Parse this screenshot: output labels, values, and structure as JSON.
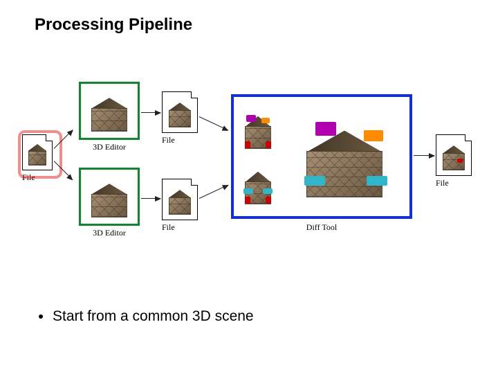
{
  "title": "Processing Pipeline",
  "bullet": "Start from a common 3D scene",
  "labels": {
    "file": "File",
    "editor": "3D Editor",
    "diff": "Diff Tool"
  },
  "diagram": {
    "description": "A source 3D scene file (highlighted) is edited in two parallel 3D Editor sessions, each producing a derived file. Both derived files feed a Diff Tool that compares the two versions and outputs a merged file.",
    "nodes": [
      {
        "id": "file_src",
        "kind": "file",
        "label_key": "file",
        "highlight": "red"
      },
      {
        "id": "editor_top",
        "kind": "editor",
        "label_key": "editor"
      },
      {
        "id": "editor_bot",
        "kind": "editor",
        "label_key": "editor"
      },
      {
        "id": "file_top",
        "kind": "file",
        "label_key": "file"
      },
      {
        "id": "file_bot",
        "kind": "file",
        "label_key": "file"
      },
      {
        "id": "diff",
        "kind": "diff",
        "label_key": "diff"
      },
      {
        "id": "file_out",
        "kind": "file",
        "label_key": "file"
      }
    ],
    "edges": [
      {
        "from": "file_src",
        "to": "editor_top"
      },
      {
        "from": "file_src",
        "to": "editor_bot"
      },
      {
        "from": "editor_top",
        "to": "file_top"
      },
      {
        "from": "editor_bot",
        "to": "file_bot"
      },
      {
        "from": "file_top",
        "to": "diff"
      },
      {
        "from": "file_bot",
        "to": "diff"
      },
      {
        "from": "diff",
        "to": "file_out"
      }
    ],
    "diff_annotations": {
      "left_thumb": [
        {
          "c": "#b000b0"
        },
        {
          "c": "#ff8c00"
        },
        {
          "c": "#d00000"
        },
        {
          "c": "#d00000"
        }
      ],
      "right_thumb": [
        {
          "c": "#2fb7c9"
        },
        {
          "c": "#2fb7c9"
        },
        {
          "c": "#d00000"
        },
        {
          "c": "#d00000"
        }
      ],
      "merged": [
        {
          "c": "#b000b0"
        },
        {
          "c": "#ff8c00"
        },
        {
          "c": "#2fb7c9"
        },
        {
          "c": "#2fb7c9"
        }
      ]
    }
  }
}
